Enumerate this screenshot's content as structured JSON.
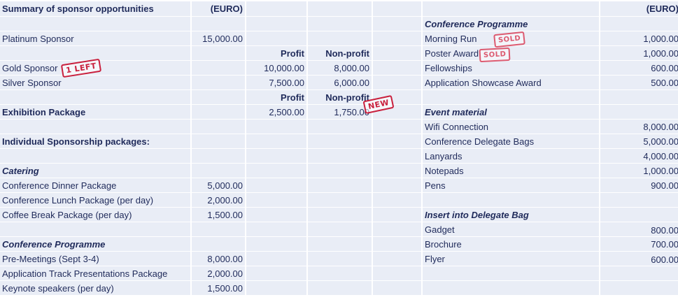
{
  "summary": {
    "title": "Summary of sponsor opportunities",
    "currency_left": "(EURO)",
    "platinum": {
      "label": "Platinum Sponsor",
      "value": "15,000.00"
    },
    "profit_header": "Profit",
    "nonprofit_header": "Non-profit",
    "gold": {
      "label": "Gold Sponsor",
      "profit": "10,000.00",
      "nonprofit": "8,000.00",
      "stamp": "1 LEFT"
    },
    "silver": {
      "label": "Silver Sponsor",
      "profit": "7,500.00",
      "nonprofit": "6,000.00"
    },
    "exhibition": {
      "label": "Exhibition Package",
      "profit": "2,500.00",
      "nonprofit": "1,750.00",
      "stamp": "NEW"
    },
    "individual": "Individual Sponsorship packages:"
  },
  "catering": {
    "heading": "Catering",
    "items": [
      {
        "label": "Conference Dinner Package",
        "value": "5,000.00"
      },
      {
        "label": "Conference Lunch Package (per day)",
        "value": "2,000.00"
      },
      {
        "label": "Coffee Break Package (per day)",
        "value": "1,500.00"
      }
    ]
  },
  "programme_left": {
    "heading": "Conference Programme",
    "items": [
      {
        "label": "Pre-Meetings (Sept 3-4)",
        "value": "8,000.00"
      },
      {
        "label": "Application Track Presentations Package",
        "value": "2,000.00"
      },
      {
        "label": "Keynote speakers (per day)",
        "value": "1,500.00"
      }
    ]
  },
  "right": {
    "currency": "(EURO)",
    "programme": {
      "heading": "Conference Programme",
      "items": [
        {
          "label": "Morning Run",
          "value": "1,000.00",
          "stamp": "SOLD"
        },
        {
          "label": "Poster Award",
          "value": "1,000.00",
          "stamp": "SOLD"
        },
        {
          "label": "Fellowships",
          "value": "600.00"
        },
        {
          "label": "Application Showcase Award",
          "value": "500.00"
        }
      ]
    },
    "event_material": {
      "heading": "Event material",
      "items": [
        {
          "label": "Wifi Connection",
          "value": "8,000.00"
        },
        {
          "label": "Conference Delegate Bags",
          "value": "5,000.00"
        },
        {
          "label": "Lanyards",
          "value": "4,000.00"
        },
        {
          "label": "Notepads",
          "value": "1,000.00"
        },
        {
          "label": "Pens",
          "value": "900.00"
        }
      ]
    },
    "insert": {
      "heading": "Insert into Delegate Bag",
      "items": [
        {
          "label": "Gadget",
          "value": "800.00"
        },
        {
          "label": "Brochure",
          "value": "700.00"
        },
        {
          "label": "Flyer",
          "value": "600.00"
        }
      ]
    }
  },
  "colors": {
    "text": "#1f2a5a",
    "cell_bg": "#e9edf6",
    "stamp": "#c9203d"
  }
}
